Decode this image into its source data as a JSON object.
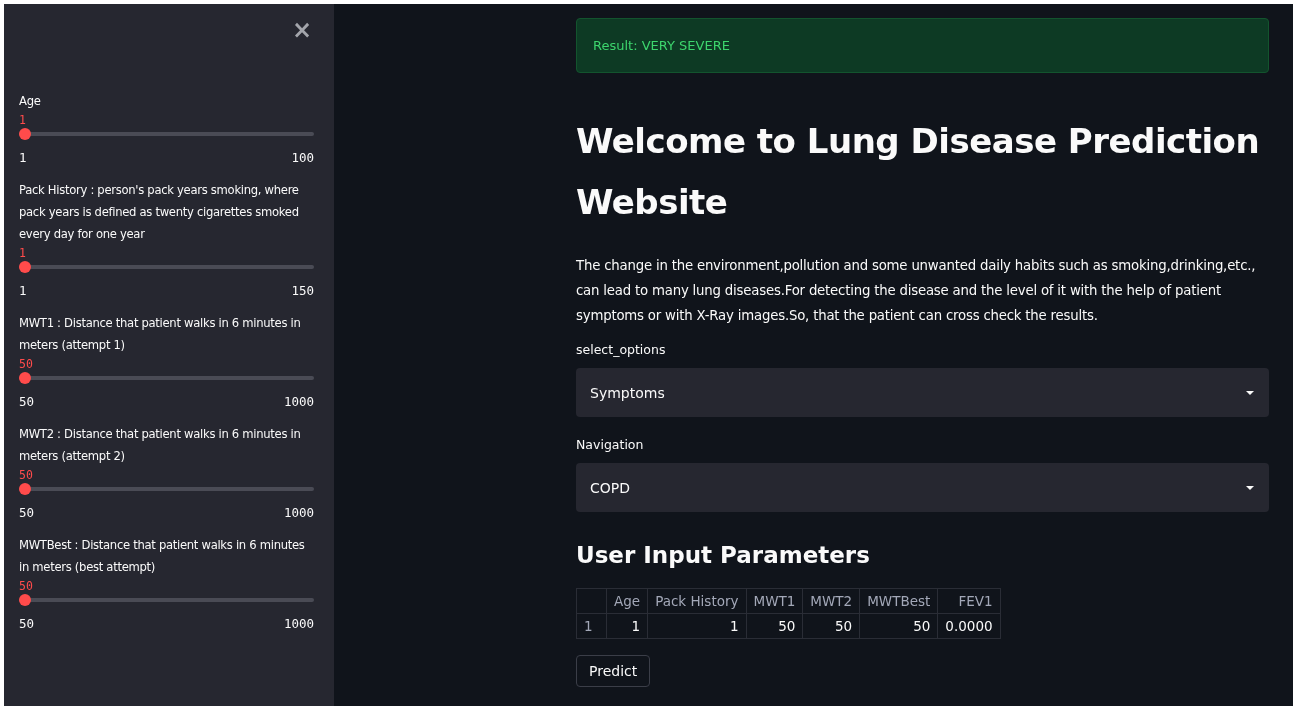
{
  "sidebar": {
    "close": "×",
    "sliders": [
      {
        "label": "Age",
        "value": "1",
        "min": "1",
        "max": "100",
        "level": 0
      },
      {
        "label": "Pack History : person's pack years smoking, where pack years is defined as twenty cigarettes smoked every day for one year",
        "value": "1",
        "min": "1",
        "max": "150",
        "level": 0
      },
      {
        "label": "MWT1 : Distance that patient walks in 6 minutes in meters (attempt 1)",
        "value": "50",
        "min": "50",
        "max": "1000",
        "level": 0
      },
      {
        "label": "MWT2 : Distance that patient walks in 6 minutes in meters (attempt 2)",
        "value": "50",
        "min": "50",
        "max": "1000",
        "level": 0
      },
      {
        "label": "MWTBest : Distance that patient walks in 6 minutes in meters (best attempt)",
        "value": "50",
        "min": "50",
        "max": "1000",
        "level": 0
      }
    ]
  },
  "main": {
    "result": "Result: VERY SEVERE",
    "title": "Welcome to Lung Disease Prediction Website",
    "intro": "The change in the environment,pollution and some unwanted daily habits such as smoking,drinking,etc., can lead to many lung diseases.For detecting the disease and the level of it with the help of patient symptoms or with X-Ray images.So, that the patient can cross check the results.",
    "selects": [
      {
        "label": "select_options",
        "value": "Symptoms"
      },
      {
        "label": "Navigation",
        "value": "COPD"
      }
    ],
    "table_title": "User Input Parameters",
    "table": {
      "columns": [
        "",
        "Age",
        "Pack History",
        "MWT1",
        "MWT2",
        "MWTBest",
        "FEV1"
      ],
      "rows": [
        [
          "1",
          "1",
          "1",
          "50",
          "50",
          "50",
          "0.0000"
        ]
      ]
    },
    "button": "Predict"
  }
}
